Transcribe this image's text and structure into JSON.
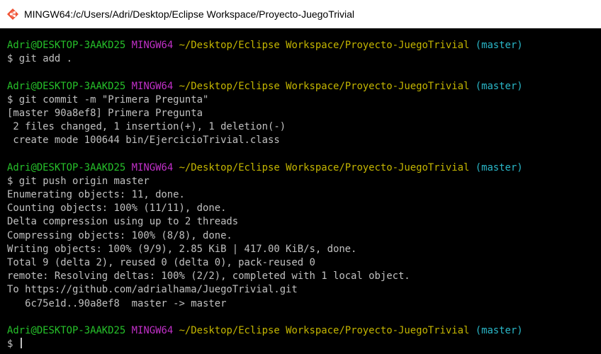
{
  "window": {
    "title": "MINGW64:/c/Users/Adri/Desktop/Eclipse Workspace/Proyecto-JuegoTrivial",
    "icon": "git-bash-icon"
  },
  "colors": {
    "user_host": "#26c12a",
    "shell": "#c130c8",
    "path": "#c4b600",
    "branch": "#2ab8c9",
    "output": "#c0c0c0",
    "background": "#000000"
  },
  "prompt": {
    "user_host": "Adri@DESKTOP-3AAKD25",
    "shell": "MINGW64",
    "path": "~/Desktop/Eclipse Workspace/Proyecto-JuegoTrivial",
    "branch": "(master)",
    "symbol": "$"
  },
  "sessions": [
    {
      "command": "git add .",
      "output": []
    },
    {
      "command": "git commit -m \"Primera Pregunta\"",
      "output": [
        "[master 90a8ef8] Primera Pregunta",
        " 2 files changed, 1 insertion(+), 1 deletion(-)",
        " create mode 100644 bin/EjercicioTrivial.class"
      ]
    },
    {
      "command": "git push origin master",
      "output": [
        "Enumerating objects: 11, done.",
        "Counting objects: 100% (11/11), done.",
        "Delta compression using up to 2 threads",
        "Compressing objects: 100% (8/8), done.",
        "Writing objects: 100% (9/9), 2.85 KiB | 417.00 KiB/s, done.",
        "Total 9 (delta 2), reused 0 (delta 0), pack-reused 0",
        "remote: Resolving deltas: 100% (2/2), completed with 1 local object.",
        "To https://github.com/adrialhama/JuegoTrivial.git",
        "   6c75e1d..90a8ef8  master -> master"
      ]
    },
    {
      "command": "",
      "output": []
    }
  ]
}
